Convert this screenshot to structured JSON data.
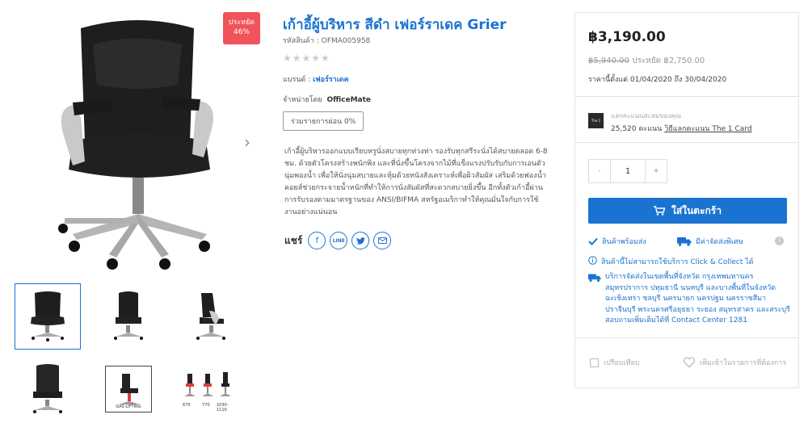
{
  "product": {
    "title": "เก้าอี้ผู้บริหาร สีดำ เฟอร์ราเดค Grier",
    "sku": "รหัสสินค้า : OFMA005958",
    "stars": "★★★★★",
    "brand_label": "แบรนด์ :",
    "brand": "เฟอร์ราเดค",
    "seller_label": "จำหน่ายโดย",
    "seller": "OfficeMate",
    "installment": "ร่วมรายการผ่อน 0%",
    "description": [
      "เก้าอี้ผู้บริหารออกแบบเรียบหรูนั่งสบายทุกท่วงท่า รองรับทุกสรีระนั่งได้สบายตลอด 6-8 ชม. ด้วยตัวโครงสร้างพนักพิง และที่นั่งขึ้นโครงจากไม้ที่แข็งแรงปรับรับกับการเอนตัว นุ่มพองน้ำ เพื่อให้นั่งนุ่มสบายและหุ้มด้วยหนังสังเคราะห์เพื่อผิวสัมผัส เสริมด้วยฟองน้ำคอยส์ช่วยกระจายน้ำหนักที่ทำให้การนั่งสัมผัสที่สะดวกสบายยิ่งขึ้น อีกทั้งตัวเก้าอี้ผ่านการรับรองตามมาตรฐานของ ANSI/BIFMA สหรัฐอเมริกาทำให้คุณมั่นใจกับการใช้งานอย่างแน่นอน"
    ]
  },
  "badge": {
    "line1": "ประหยัด",
    "line2": "46%"
  },
  "gallery": {
    "gas_label": "GAS LIFTING",
    "dims": [
      "670",
      "770",
      "1030-1110"
    ]
  },
  "share": {
    "label": "แชร์",
    "icons": [
      "facebook-icon",
      "line-icon",
      "twitter-icon",
      "email-icon"
    ]
  },
  "panel": {
    "price": "฿3,190.00",
    "old_price": "฿5,940.00",
    "save_label": "ประหยัด",
    "save_amount": "฿2,750.00",
    "period": "ราคานี้ตั้งแต่ 01/04/2020 ถึง 30/04/2020",
    "t1_label": "แลกคะแนนสะสมของคุณ",
    "t1_points": "25,520 คะแนน",
    "t1_link": "วิธีแลกคะแนน The 1 Card",
    "qty_minus": "-",
    "qty": "1",
    "qty_plus": "+",
    "cart": "ใส่ในตะกร้า",
    "in_stock": "สินค้าพร้อมส่ง",
    "delivery_service": "มีค่าจัดส่งพิเศษ",
    "notice": "สินค้านี้ไม่สามารถใช้บริการ Click & Collect ได้",
    "delivery_text": "บริการจัดส่งในเขตพื้นที่จังหวัด กรุงเทพมหานคร สมุทรปราการ ปทุมธานี นนทบุรี และบางพื้นที่ในจังหวัด ฉะเชิงเทรา ชลบุรี นครนายก นครปฐม นครราชสีมา ปราจีนบุรี พระนครศรีอยุธยา ระยอง สมุทรสาคร และสระบุรี สอบถามเพิ่มเติมได้ที่ Contact Center 1281",
    "compare": "เปรียบเทียบ",
    "wishlist": "เพิ่มเข้าในรายการที่ต้องการ"
  },
  "colors": {
    "accent": "#1a73d1",
    "badge": "#f0535b"
  }
}
